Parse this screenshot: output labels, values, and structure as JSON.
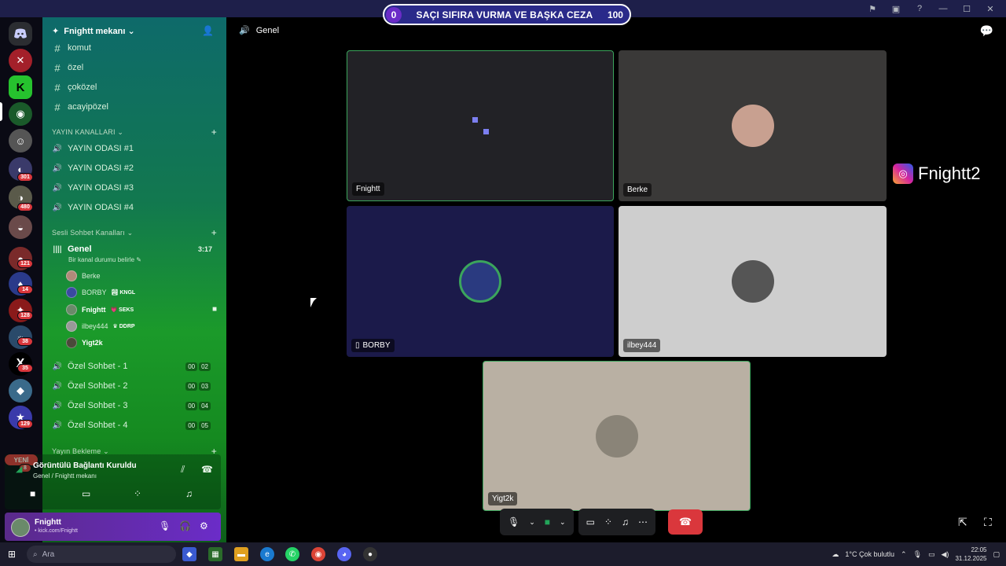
{
  "window": {
    "title": "Fnightt mekanı"
  },
  "banner": {
    "left_count": "0",
    "text": "SAÇI SIFIRA VURMA VE BAŞKA CEZA",
    "right_count": "100"
  },
  "rail": {
    "badges": [
      "301",
      "480",
      "121",
      "14",
      "128",
      "38",
      "35",
      "129",
      "8"
    ],
    "new_label": "YENİ"
  },
  "server": {
    "name": "Fnightt mekanı ⌄"
  },
  "text_channels": [
    "komut",
    "özel",
    "çoközel",
    "acayipözel"
  ],
  "categories": {
    "stream": "YAYIN KANALLARI ⌄",
    "voice": "Sesli Sohbet Kanalları ⌄",
    "waiting": "Yayın Bekleme ⌄"
  },
  "stream_channels": [
    "YAYIN ODASI #1",
    "YAYIN ODASI #2",
    "YAYIN ODASI #3",
    "YAYIN ODASI #4"
  ],
  "voice_channel": {
    "name": "Genel",
    "timer": "3:17",
    "status": "Bir kanal durumu belirle ✎"
  },
  "voice_users": [
    {
      "name": "Berke",
      "tag": ""
    },
    {
      "name": "BORBY",
      "tag": "🏞 KNGL"
    },
    {
      "name": "Fnightt",
      "tag": "💗 SEKS"
    },
    {
      "name": "ilbey444",
      "tag": "♛ DDRP"
    },
    {
      "name": "Yigt2k",
      "tag": ""
    }
  ],
  "private_channels": [
    {
      "name": "Özel Sohbet - 1",
      "a": "00",
      "b": "02"
    },
    {
      "name": "Özel Sohbet - 2",
      "a": "00",
      "b": "03"
    },
    {
      "name": "Özel Sohbet - 3",
      "a": "00",
      "b": "04"
    },
    {
      "name": "Özel Sohbet - 4",
      "a": "00",
      "b": "05"
    }
  ],
  "connection": {
    "status": "Görüntülü Bağlantı Kuruldu",
    "sub": "Genel / Fnightt mekanı"
  },
  "user": {
    "name": "Fnightt",
    "status": "• kick.com/Fnightt"
  },
  "main": {
    "channel": "Genel"
  },
  "tiles": {
    "t1": "Fnightt",
    "t2": "Berke",
    "t3": "BORBY",
    "t4": "ilbey444",
    "t5": "Yigt2k"
  },
  "overlay": {
    "instagram": "Fnightt2"
  },
  "taskbar": {
    "search": "Ara",
    "weather": "1°C  Çok bulutlu",
    "time": "22:05",
    "date": "31.12.2025"
  }
}
